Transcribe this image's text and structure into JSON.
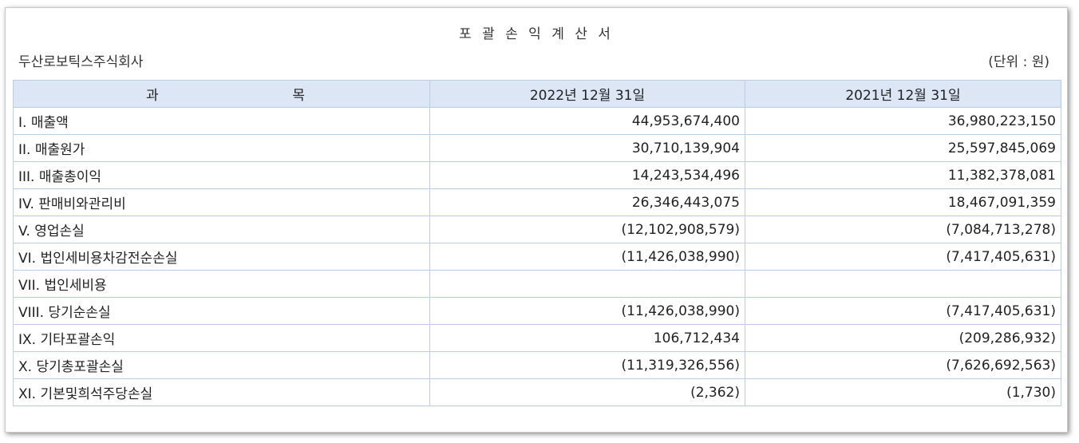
{
  "title": "포 괄 손 익 계 산 서",
  "company": "두산로보틱스주식회사",
  "unit": "(단위 : 원)",
  "table": {
    "headers": {
      "item_part1": "과",
      "item_part2": "목",
      "col1": "2022년 12월 31일",
      "col2": "2021년 12월 31일"
    },
    "rows": [
      {
        "label": "I. 매출액",
        "v2022": "44,953,674,400",
        "v2021": "36,980,223,150"
      },
      {
        "label": "II. 매출원가",
        "v2022": "30,710,139,904",
        "v2021": "25,597,845,069"
      },
      {
        "label": "III. 매출총이익",
        "v2022": "14,243,534,496",
        "v2021": "11,382,378,081"
      },
      {
        "label": "IV. 판매비와관리비",
        "v2022": "26,346,443,075",
        "v2021": "18,467,091,359"
      },
      {
        "label": "V. 영업손실",
        "v2022": "(12,102,908,579)",
        "v2021": "(7,084,713,278)"
      },
      {
        "label": "VI. 법인세비용차감전순손실",
        "v2022": "(11,426,038,990)",
        "v2021": "(7,417,405,631)"
      },
      {
        "label": "VII. 법인세비용",
        "v2022": "",
        "v2021": ""
      },
      {
        "label": "VIII. 당기순손실",
        "v2022": "(11,426,038,990)",
        "v2021": "(7,417,405,631)"
      },
      {
        "label": "IX. 기타포괄손익",
        "v2022": "106,712,434",
        "v2021": "(209,286,932)"
      },
      {
        "label": "X. 당기총포괄손실",
        "v2022": "(11,319,326,556)",
        "v2021": "(7,626,692,563)"
      },
      {
        "label": "XI. 기본및희석주당손실",
        "v2022": "(2,362)",
        "v2021": "(1,730)"
      }
    ]
  }
}
